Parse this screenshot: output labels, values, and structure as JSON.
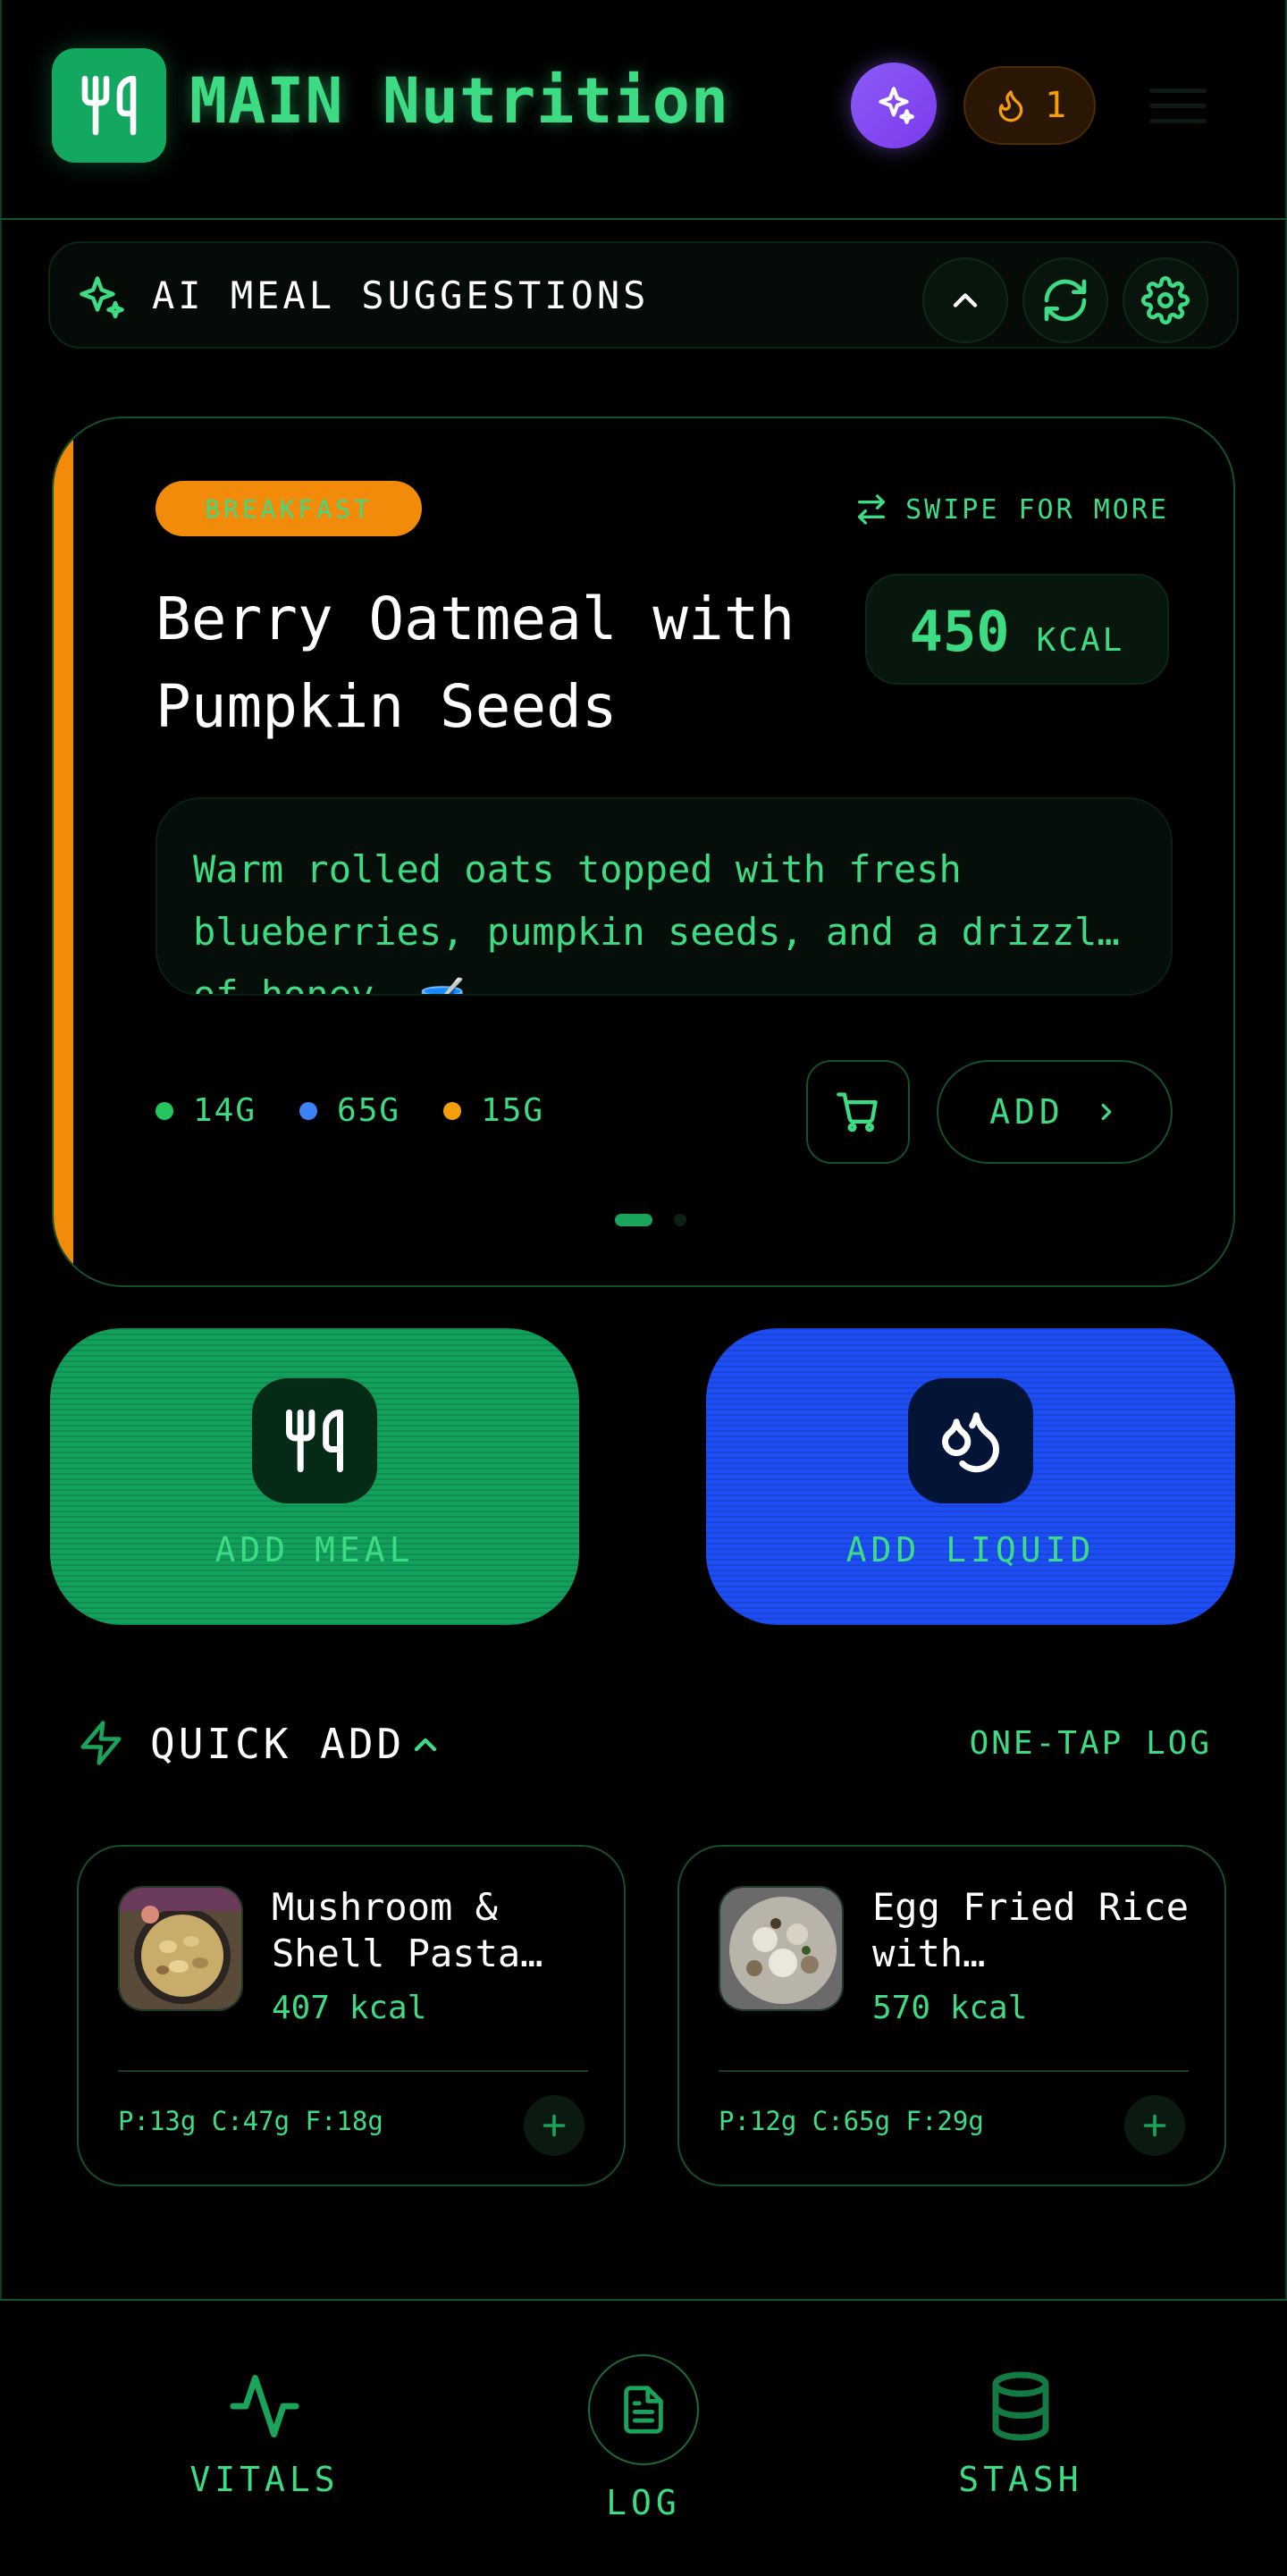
{
  "header": {
    "title": "MAIN Nutrition",
    "streak_count": "1",
    "logo_icon": "fork-knife-icon",
    "ai_icon": "sparkles-icon",
    "streak_icon": "flame-icon",
    "menu_icon": "hamburger-menu-icon"
  },
  "ai_bar": {
    "label": "AI MEAL SUGGESTIONS",
    "icons": [
      "sparkles-icon",
      "chevron-up-icon",
      "refresh-icon",
      "gear-icon"
    ]
  },
  "meal_card": {
    "tag": "BREAKFAST",
    "swipe_hint": "SWIPE FOR MORE",
    "title": "Berry Oatmeal with Pumpkin Seeds",
    "kcal_value": "450",
    "kcal_unit": "KCAL",
    "description": "Warm rolled oats topped with fresh blueberries, pumpkin seeds, and a drizzl… of honey. 🥣",
    "macros": [
      {
        "value": "14G",
        "color": "#22c55e"
      },
      {
        "value": "65G",
        "color": "#3b82f6"
      },
      {
        "value": "15G",
        "color": "#f59e0b"
      }
    ],
    "add_label": "ADD",
    "accent_color": "#f28a0a",
    "page_index": 1,
    "page_count": 2
  },
  "actions": {
    "add_meal": "ADD MEAL",
    "add_liquid": "ADD LIQUID",
    "meal_color": "#12a05c",
    "liquid_color": "#1d4ef5"
  },
  "quick_add": {
    "title": "QUICK ADD",
    "right_label": "ONE-TAP LOG",
    "items": [
      {
        "name": "Mushroom & Shell Pasta…",
        "kcal": "407 kcal",
        "macros": "P:13g C:47g F:18g"
      },
      {
        "name": "Egg Fried Rice with…",
        "kcal": "570 kcal",
        "macros": "P:12g C:65g F:29g"
      }
    ]
  },
  "bottom_nav": {
    "items": [
      {
        "label": "VITALS",
        "icon": "pulse-icon"
      },
      {
        "label": "LOG",
        "icon": "document-icon"
      },
      {
        "label": "STASH",
        "icon": "database-icon"
      }
    ]
  }
}
